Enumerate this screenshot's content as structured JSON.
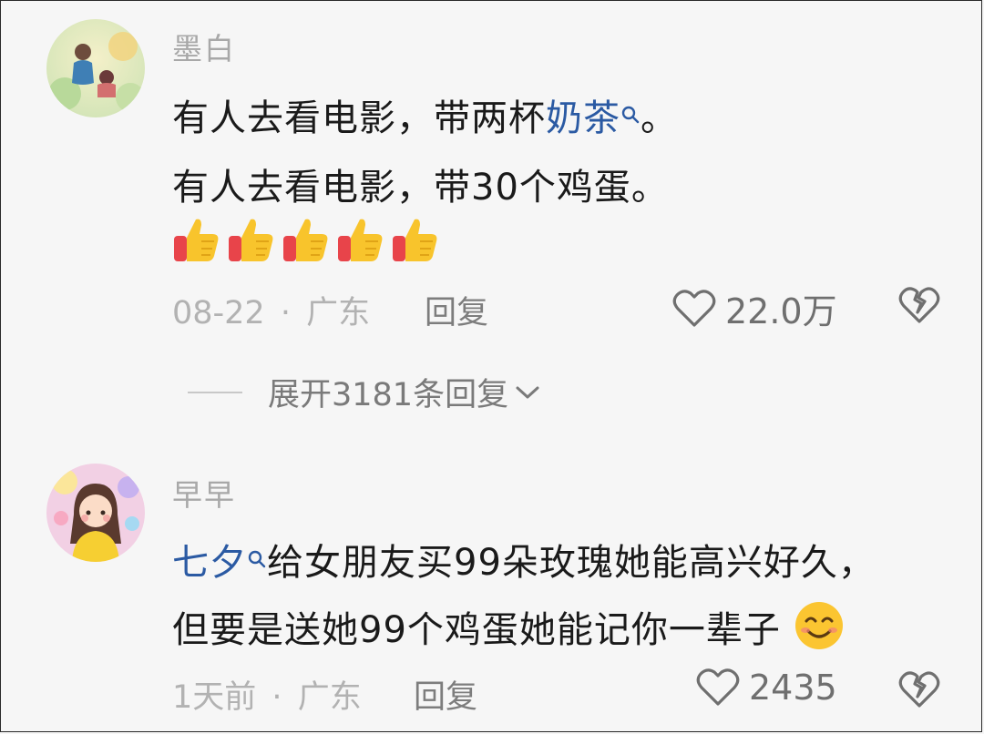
{
  "comments": [
    {
      "username": "墨白",
      "lines": [
        {
          "before": "有人去看电影，带两杯",
          "link": "奶茶",
          "after": "。"
        },
        {
          "text": "有人去看电影，带30个鸡蛋。"
        }
      ],
      "emoji_icon": "thumbs-up-icon",
      "emoji_count": 5,
      "date": "08-22",
      "separator": "·",
      "location": "广东",
      "reply_label": "回复",
      "likes": "22.0万",
      "expand_label": "展开3181条回复"
    },
    {
      "username": "早早",
      "lines": [
        {
          "link": "七夕",
          "after": "给女朋友买99朵玫瑰她能高兴好久，"
        },
        {
          "text": "但要是送她99个鸡蛋她能记你一辈子"
        }
      ],
      "emoji_icon": "smiling-face-icon",
      "date": "1天前",
      "separator": "·",
      "location": "广东",
      "reply_label": "回复",
      "likes": "2435"
    }
  ],
  "colors": {
    "background": "#f6f6f6",
    "username": "#a8a8a8",
    "body_text": "#1a1a1a",
    "link": "#2b5aa3",
    "meta": "#b2b2b2"
  }
}
